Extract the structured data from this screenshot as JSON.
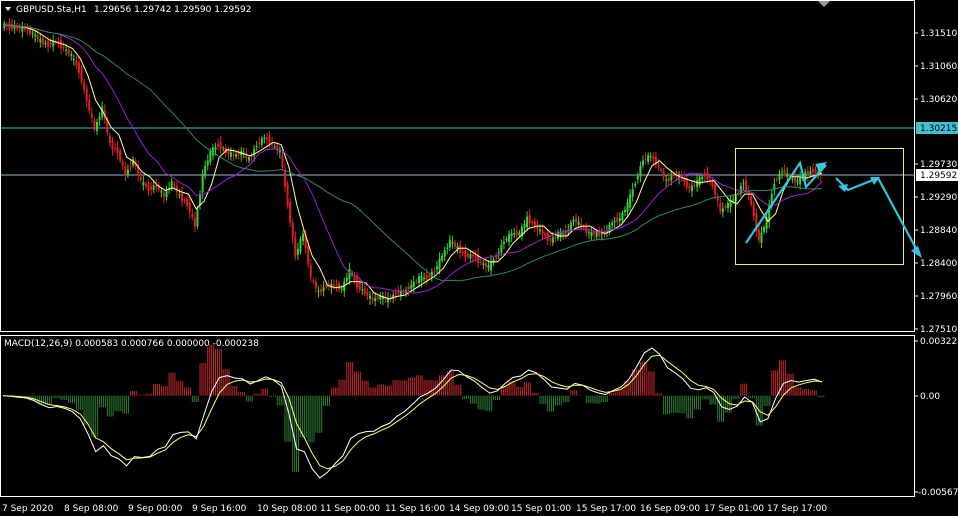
{
  "header": {
    "symbol": "GBPUSD.Sta,H1",
    "ohlc": "1.29656 1.29742 1.29590 1.29592"
  },
  "macd": {
    "title": "MACD(12,26,9) 0.000583 0.000766 0.000000 -0.000238"
  },
  "chart_data": [
    {
      "type": "candlestick",
      "title": "GBPUSD.Sta,H1",
      "y_ticks": [
        "1.31510",
        "1.31060",
        "1.30620",
        "1.30215",
        "1.29730",
        "1.29592",
        "1.29290",
        "1.28840",
        "1.28400",
        "1.27960",
        "1.27510"
      ],
      "ylim": [
        1.2745,
        1.3193
      ],
      "price_lines": [
        {
          "value": 1.30215,
          "label": "1.30215",
          "color": "#40c0d0"
        },
        {
          "value": 1.29592,
          "label": "1.29592",
          "color": "#9fb6d8"
        }
      ],
      "close_series": [
        1.3162,
        1.316,
        1.3158,
        1.3157,
        1.315,
        1.314,
        1.3135,
        1.314,
        1.313,
        1.312,
        1.31,
        1.306,
        1.302,
        1.305,
        1.3,
        1.299,
        1.296,
        1.298,
        1.295,
        1.294,
        1.2945,
        1.293,
        1.295,
        1.293,
        1.292,
        1.289,
        1.296,
        1.299,
        1.3,
        1.299,
        1.2985,
        1.299,
        1.298,
        1.3,
        1.301,
        1.3,
        1.299,
        1.292,
        1.285,
        1.288,
        1.282,
        1.28,
        1.281,
        1.281,
        1.2805,
        1.283,
        1.281,
        1.28,
        1.279,
        1.2795,
        1.279,
        1.28,
        1.28,
        1.281,
        1.282,
        1.282,
        1.283,
        1.285,
        1.287,
        1.286,
        1.285,
        1.285,
        1.284,
        1.2835,
        1.285,
        1.287,
        1.288,
        1.288,
        1.29,
        1.289,
        1.288,
        1.287,
        1.288,
        1.288,
        1.29,
        1.289,
        1.288,
        1.288,
        1.288,
        1.2895,
        1.29,
        1.292,
        1.295,
        1.298,
        1.2985,
        1.297,
        1.295,
        1.296,
        1.2955,
        1.294,
        1.295,
        1.296,
        1.2945,
        1.291,
        1.292,
        1.293,
        1.295,
        1.292,
        1.287,
        1.29,
        1.295,
        1.2965,
        1.2955,
        1.295,
        1.296,
        1.2965,
        1.2959
      ],
      "ma_colors": {
        "fast": "#ffffa0",
        "mid": "#a020d0",
        "slow": "#2e8b57"
      },
      "forecast_box": {
        "color": "#f0f060"
      },
      "x_ticks": [
        "7 Sep 2020",
        "8 Sep 08:00",
        "9 Sep 00:00",
        "9 Sep 16:00",
        "10 Sep 08:00",
        "11 Sep 00:00",
        "11 Sep 16:00",
        "14 Sep 09:00",
        "15 Sep 01:00",
        "15 Sep 17:00",
        "16 Sep 09:00",
        "17 Sep 01:00",
        "17 Sep 17:00"
      ]
    },
    {
      "type": "bar+line",
      "title": "MACD(12,26,9) 0.000583 0.000766 0.000000 -0.000238",
      "y_ticks": [
        "0.003222",
        "0.00",
        "-0.005678"
      ],
      "ylim": [
        -0.005678,
        0.003222
      ],
      "histogram_colors": {
        "positive": "#c0282a",
        "negative": "#2e7d32"
      },
      "line_colors": {
        "macd": "#ffffff",
        "signal": "#ffff66"
      }
    }
  ]
}
